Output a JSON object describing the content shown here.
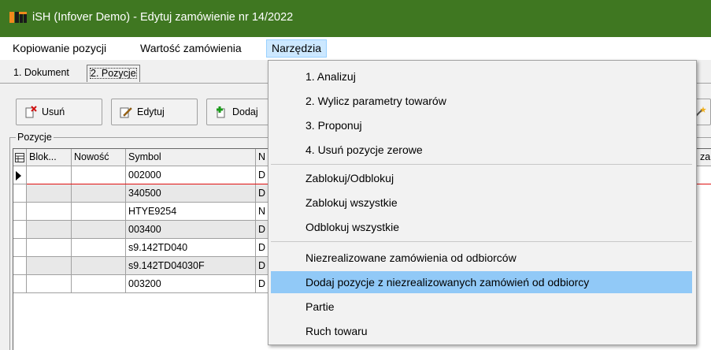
{
  "window": {
    "title": "iSH (Infover Demo) - Edytuj zamówienie nr 14/2022"
  },
  "menubar": {
    "items": [
      {
        "label": "Kopiowanie pozycji"
      },
      {
        "label": "Wartość zamówienia"
      },
      {
        "label": "Narzędzia"
      }
    ]
  },
  "tabs": [
    {
      "label": "1. Dokument"
    },
    {
      "label": "2. Pozycje"
    }
  ],
  "toolbar": {
    "delete_label": "Usuń",
    "edit_label": "Edytuj",
    "add_label": "Dodaj"
  },
  "group": {
    "label": "Pozycje"
  },
  "grid": {
    "headers": [
      "Blok...",
      "Nowość",
      "Symbol",
      "N"
    ],
    "header_right_fragment": "zak",
    "rows": [
      {
        "blok": "",
        "nowosc": "",
        "symbol": "002000",
        "n": "D"
      },
      {
        "blok": "",
        "nowosc": "",
        "symbol": "340500",
        "n": "D"
      },
      {
        "blok": "",
        "nowosc": "",
        "symbol": "HTYE9254",
        "n": "N"
      },
      {
        "blok": "",
        "nowosc": "",
        "symbol": "003400",
        "n": "D"
      },
      {
        "blok": "",
        "nowosc": "",
        "symbol": "s9.142TD040",
        "n": "D"
      },
      {
        "blok": "",
        "nowosc": "",
        "symbol": "s9.142TD04030F",
        "n": "D"
      },
      {
        "blok": "",
        "nowosc": "",
        "symbol": "003200",
        "n": "D"
      }
    ]
  },
  "dropdown": {
    "items": [
      {
        "label": "1. Analizuj"
      },
      {
        "label": "2. Wylicz parametry towarów"
      },
      {
        "label": "3. Proponuj"
      },
      {
        "label": "4. Usuń pozycje zerowe"
      },
      {
        "label": "Zablokuj/Odblokuj"
      },
      {
        "label": "Zablokuj wszystkie"
      },
      {
        "label": "Odblokuj wszystkie"
      },
      {
        "label": "Niezrealizowane zamówienia od odbiorców"
      },
      {
        "label": "Dodaj pozycje z niezrealizowanych zamówień od odbiorcy"
      },
      {
        "label": "Partie"
      },
      {
        "label": "Ruch towaru"
      }
    ],
    "highlighted_index": 8
  },
  "colors": {
    "titlebar": "#3f7721",
    "menu_active": "#cce8ff",
    "dropdown_highlight": "#91c9f7",
    "current_row_line": "#e01010"
  }
}
